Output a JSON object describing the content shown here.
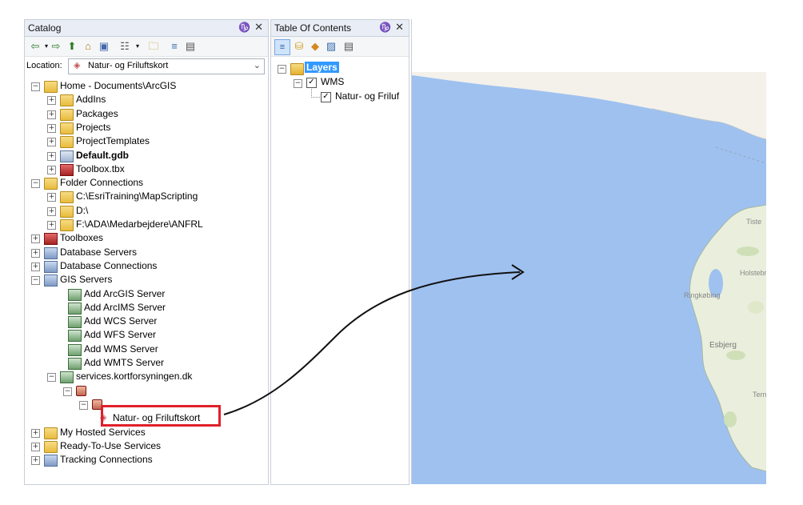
{
  "catalog": {
    "title": "Catalog",
    "pin": "♑",
    "close": "✕",
    "location_label": "Location:",
    "location_value": "Natur- og Friluftskort",
    "tree": [
      {
        "label": "Home - Documents\\ArcGIS",
        "exp": "−"
      },
      {
        "label": "AddIns",
        "exp": "+"
      },
      {
        "label": "Packages",
        "exp": "+"
      },
      {
        "label": "Projects",
        "exp": "+"
      },
      {
        "label": "ProjectTemplates",
        "exp": "+"
      },
      {
        "label": "Default.gdb",
        "exp": "+"
      },
      {
        "label": "Toolbox.tbx",
        "exp": "+"
      },
      {
        "label": "Folder Connections",
        "exp": "−"
      },
      {
        "label": "C:\\EsriTraining\\MapScripting",
        "exp": "+"
      },
      {
        "label": "D:\\",
        "exp": "+"
      },
      {
        "label": "F:\\ADA\\Medarbejdere\\ANFRL",
        "exp": "+"
      },
      {
        "label": "Toolboxes",
        "exp": "+"
      },
      {
        "label": "Database Servers",
        "exp": "+"
      },
      {
        "label": "Database Connections",
        "exp": "+"
      },
      {
        "label": "GIS Servers",
        "exp": "−"
      },
      {
        "label": "Add ArcGIS Server",
        "exp": ""
      },
      {
        "label": "Add ArcIMS Server",
        "exp": ""
      },
      {
        "label": "Add WCS Server",
        "exp": ""
      },
      {
        "label": "Add WFS Server",
        "exp": ""
      },
      {
        "label": "Add WMS Server",
        "exp": ""
      },
      {
        "label": "Add WMTS Server",
        "exp": ""
      },
      {
        "label": "services.kortforsyningen.dk",
        "exp": "−"
      },
      {
        "label": "",
        "exp": "−"
      },
      {
        "label": "",
        "exp": "−"
      },
      {
        "label": "Natur- og Friluftskort",
        "exp": ""
      },
      {
        "label": "My Hosted Services",
        "exp": "+"
      },
      {
        "label": "Ready-To-Use Services",
        "exp": "+"
      },
      {
        "label": "Tracking Connections",
        "exp": "+"
      }
    ]
  },
  "toc": {
    "title": "Table Of Contents",
    "pin": "♑",
    "close": "✕",
    "layers_label": "Layers",
    "wms_label": "WMS",
    "sublayer_label": "Natur- og Friluf"
  },
  "map": {
    "labels": [
      "Holstebr",
      "Ringkøbing",
      "Esbjerg",
      "Tern",
      "Tiste"
    ]
  },
  "colors": {
    "sea": "#9ec1f0",
    "land": "#f3f1ea",
    "highlight": "#e0202a",
    "selection": "#3399ff"
  }
}
